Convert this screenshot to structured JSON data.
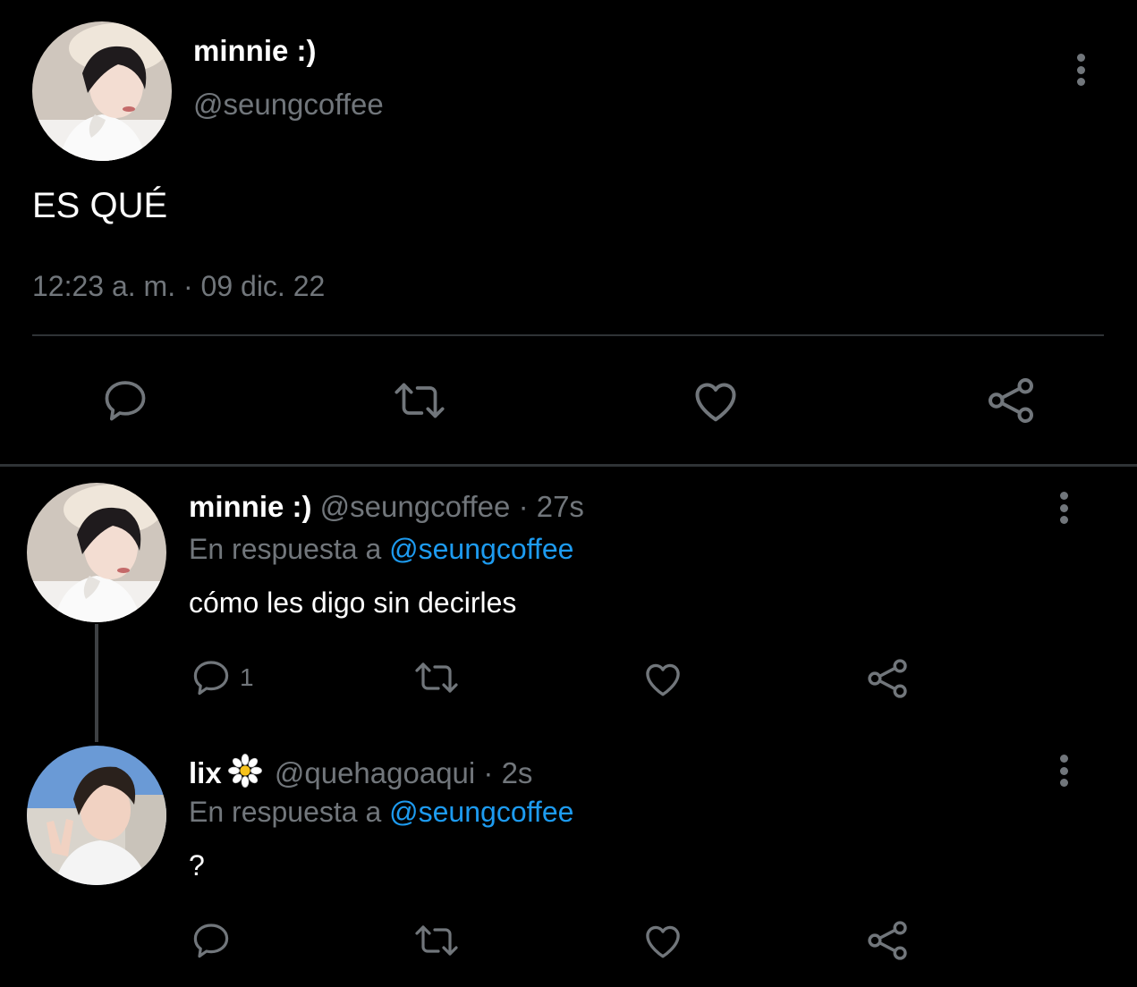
{
  "main_tweet": {
    "display_name": "minnie :)",
    "handle": "@seungcoffee",
    "text": "ES QUÉ",
    "timestamp": "12:23 a. m. · 09 dic. 22",
    "actions": [
      "reply-icon",
      "retweet-icon",
      "like-icon",
      "share-icon"
    ]
  },
  "replies": [
    {
      "display_name": "minnie :)",
      "handle": "@seungcoffee",
      "time": "· 27s",
      "reply_prefix": "En respuesta a",
      "reply_mention": "@seungcoffee",
      "text": "cómo les digo sin decirles",
      "reply_count": "1"
    },
    {
      "display_name": "lix",
      "name_emoji": "daisy-icon",
      "handle": "@quehagoaqui",
      "time": "· 2s",
      "reply_prefix": "En respuesta a",
      "reply_mention": "@seungcoffee",
      "text": "?"
    }
  ],
  "colors": {
    "background": "#000000",
    "primary_text": "#ffffff",
    "secondary_text": "#71767b",
    "link": "#1d9bf0",
    "divider": "#2f3336"
  }
}
